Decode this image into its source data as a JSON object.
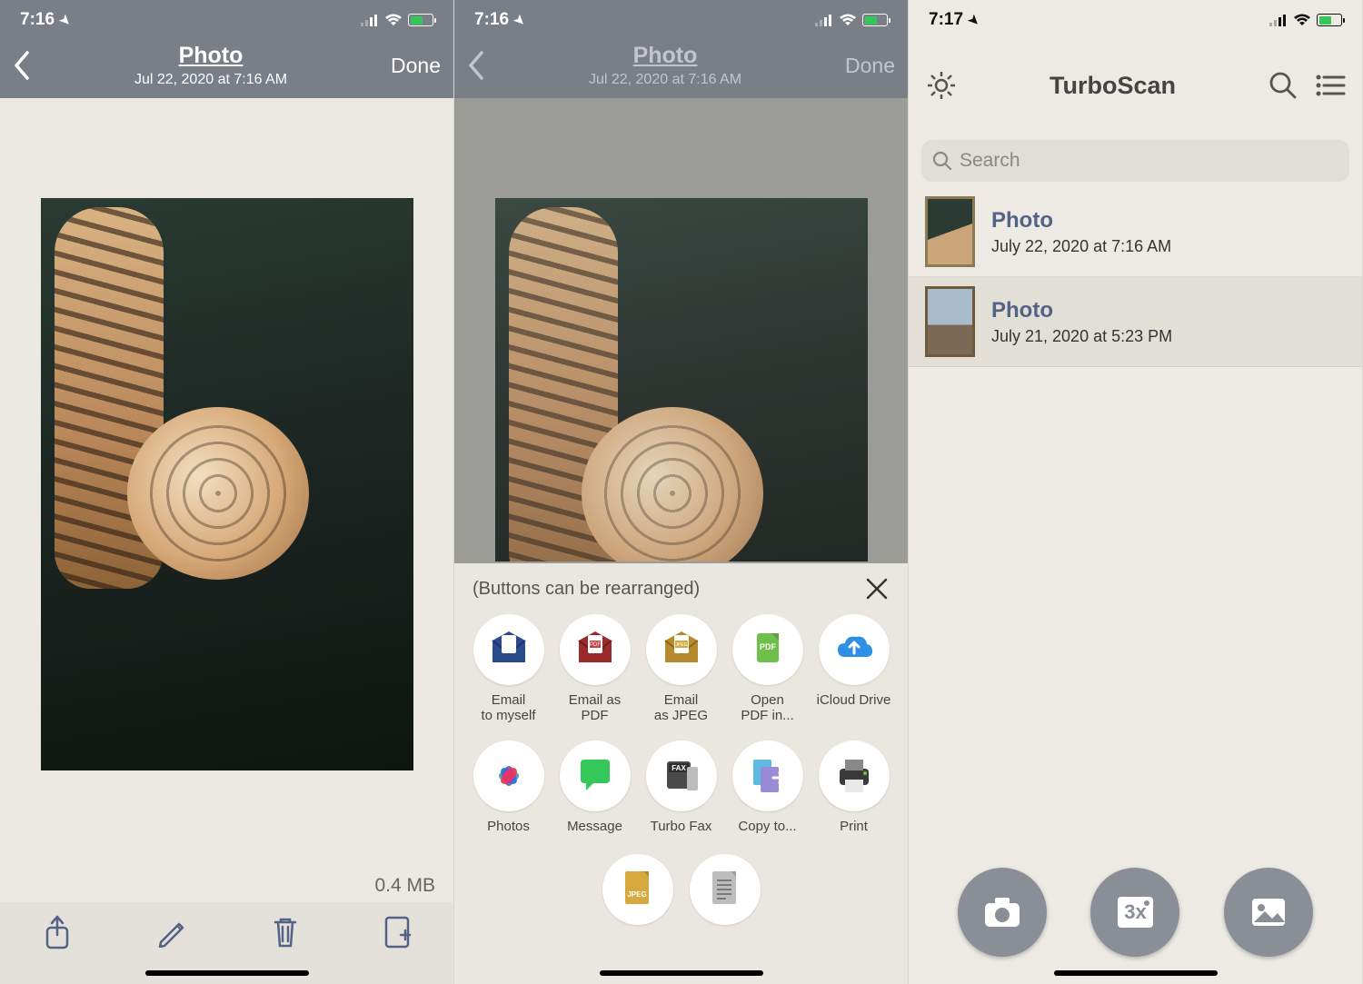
{
  "status": {
    "time_a": "7:16",
    "time_b": "7:16",
    "time_c": "7:17"
  },
  "screen1": {
    "title": "Photo",
    "subtitle": "Jul 22, 2020 at 7:16 AM",
    "done": "Done",
    "file_size": "0.4 MB"
  },
  "screen2": {
    "title": "Photo",
    "subtitle": "Jul 22, 2020 at 7:16 AM",
    "done": "Done",
    "hint": "(Buttons can be rearranged)",
    "actions": [
      {
        "label": "Email\nto myself",
        "icon": "envelope-blue"
      },
      {
        "label": "Email as PDF",
        "icon": "envelope-red-pdf"
      },
      {
        "label": "Email\nas JPEG",
        "icon": "envelope-gold-jpeg"
      },
      {
        "label": "Open\nPDF in...",
        "icon": "pdf-open"
      },
      {
        "label": "iCloud Drive",
        "icon": "icloud"
      },
      {
        "label": "Photos",
        "icon": "photos-flower"
      },
      {
        "label": "Message",
        "icon": "message-bubble"
      },
      {
        "label": "Turbo Fax",
        "icon": "fax"
      },
      {
        "label": "Copy to...",
        "icon": "copy"
      },
      {
        "label": "Print",
        "icon": "printer"
      }
    ],
    "extra": [
      {
        "icon": "jpeg-page"
      },
      {
        "icon": "text-page"
      }
    ]
  },
  "screen3": {
    "app_title": "TurboScan",
    "search_placeholder": "Search",
    "docs": [
      {
        "title": "Photo",
        "subtitle": "July 22, 2020  at 7:16 AM"
      },
      {
        "title": "Photo",
        "subtitle": "July 21, 2020  at 5:23 PM"
      }
    ]
  }
}
